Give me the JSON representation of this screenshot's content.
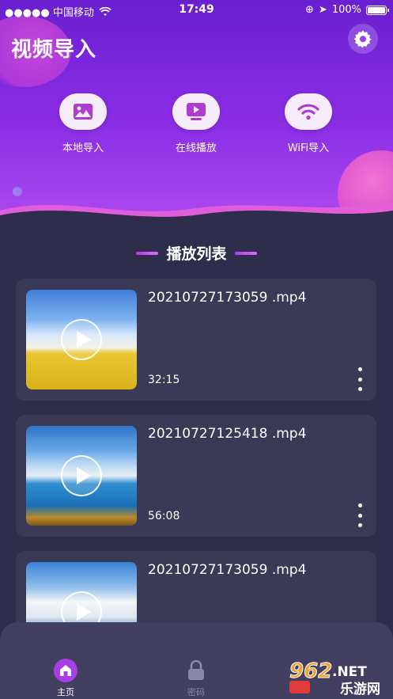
{
  "status": {
    "carrier": "●●●●● 中国移动",
    "time": "17:49",
    "battery": "100%",
    "battery_level": 1.0
  },
  "header": {
    "title": "视频导入"
  },
  "actions": [
    {
      "label": "本地导入",
      "icon": "image-icon"
    },
    {
      "label": "在线播放",
      "icon": "play-screen-icon"
    },
    {
      "label": "WiFi导入",
      "icon": "wifi-icon"
    }
  ],
  "section": {
    "title": "播放列表"
  },
  "videos": [
    {
      "filename": "20210727173059 .mp4",
      "duration": "32:15"
    },
    {
      "filename": "20210727125418 .mp4",
      "duration": "56:08"
    },
    {
      "filename": "20210727173059 .mp4",
      "duration": ""
    }
  ],
  "tabs": [
    {
      "label": "主页",
      "icon": "home-icon",
      "active": true
    },
    {
      "label": "密码",
      "icon": "lock-icon",
      "active": false
    },
    {
      "label": "",
      "icon": "tab-icon",
      "active": false
    }
  ],
  "watermark": {
    "number": "962",
    "suffix": ".NET",
    "text": "乐游网"
  },
  "colors": {
    "accent": "#8b2ee6",
    "background": "#2e2d4b",
    "card": "#3a3956",
    "tab_active": "#a640e6"
  }
}
